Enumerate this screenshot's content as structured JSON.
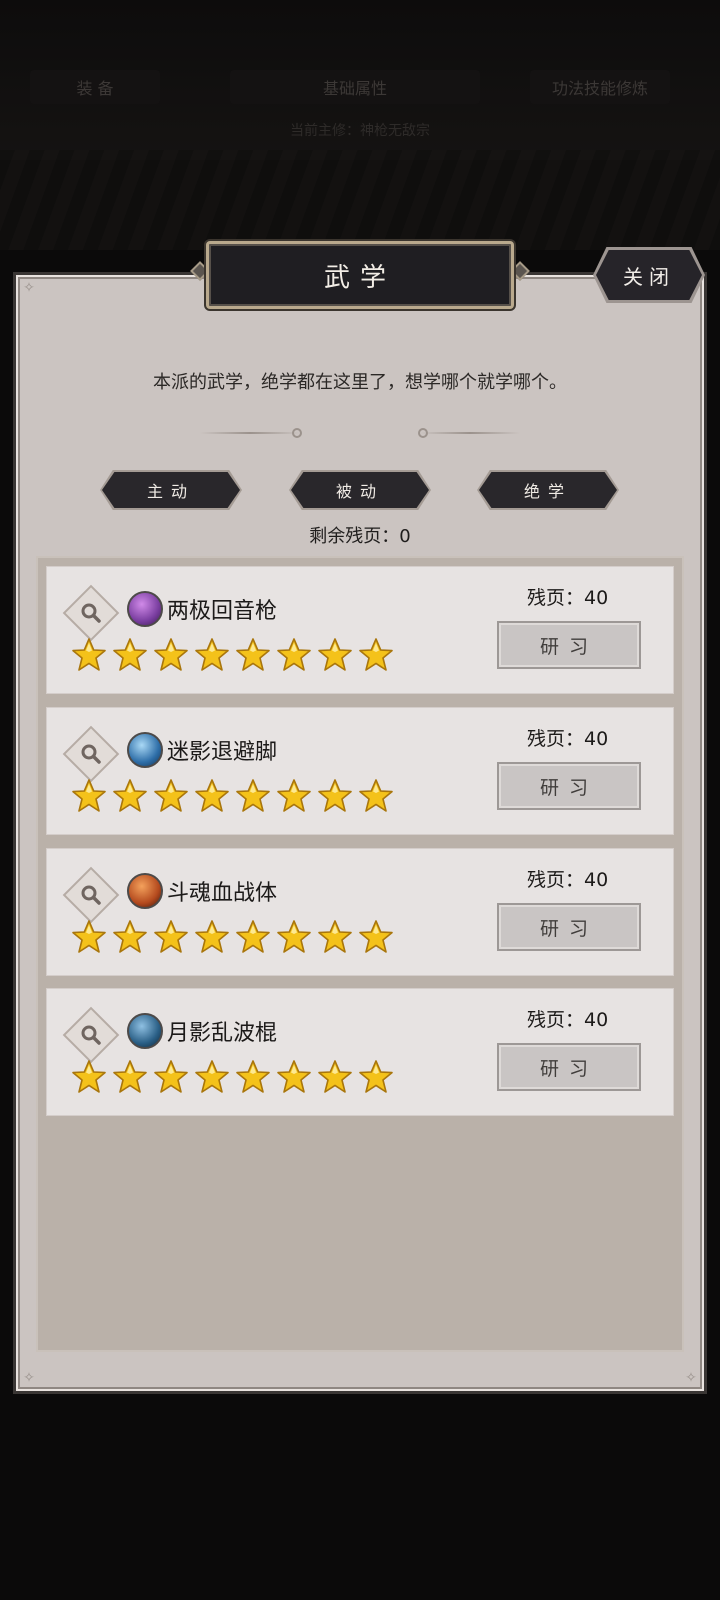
{
  "background": {
    "left_chip": "装 备",
    "center_chip": "基础属性",
    "right_chip": "功法技能修炼",
    "subtitle": "当前主修：神枪无敌宗"
  },
  "panel": {
    "title": "武学",
    "close_label": "关闭",
    "intro": "本派的武学，绝学都在这里了，想学哪个就学哪个。",
    "tabs": [
      {
        "label": "主动"
      },
      {
        "label": "被动"
      },
      {
        "label": "绝学"
      }
    ],
    "remaining": "剩余残页：0"
  },
  "skills": [
    {
      "name": "两极回音枪",
      "pages": "残页：40",
      "stars": 8,
      "study_label": "研习",
      "icon": "spear-icon",
      "icon_color": "#7a3ea0"
    },
    {
      "name": "迷影退避脚",
      "pages": "残页：40",
      "stars": 8,
      "study_label": "研习",
      "icon": "boot-icon",
      "icon_color": "#2e6ea8"
    },
    {
      "name": "斗魂血战体",
      "pages": "残页：40",
      "stars": 8,
      "study_label": "研习",
      "icon": "blade-icon",
      "icon_color": "#b44a1e"
    },
    {
      "name": "月影乱波棍",
      "pages": "残页：40",
      "stars": 8,
      "study_label": "研习",
      "icon": "staff-icon",
      "icon_color": "#2a5f86"
    }
  ],
  "colors": {
    "panel_bg": "#cbc4c1",
    "card_bg": "#e7e3e2",
    "title_bg": "#1f1e22",
    "star_fill": "#f4c21a"
  }
}
